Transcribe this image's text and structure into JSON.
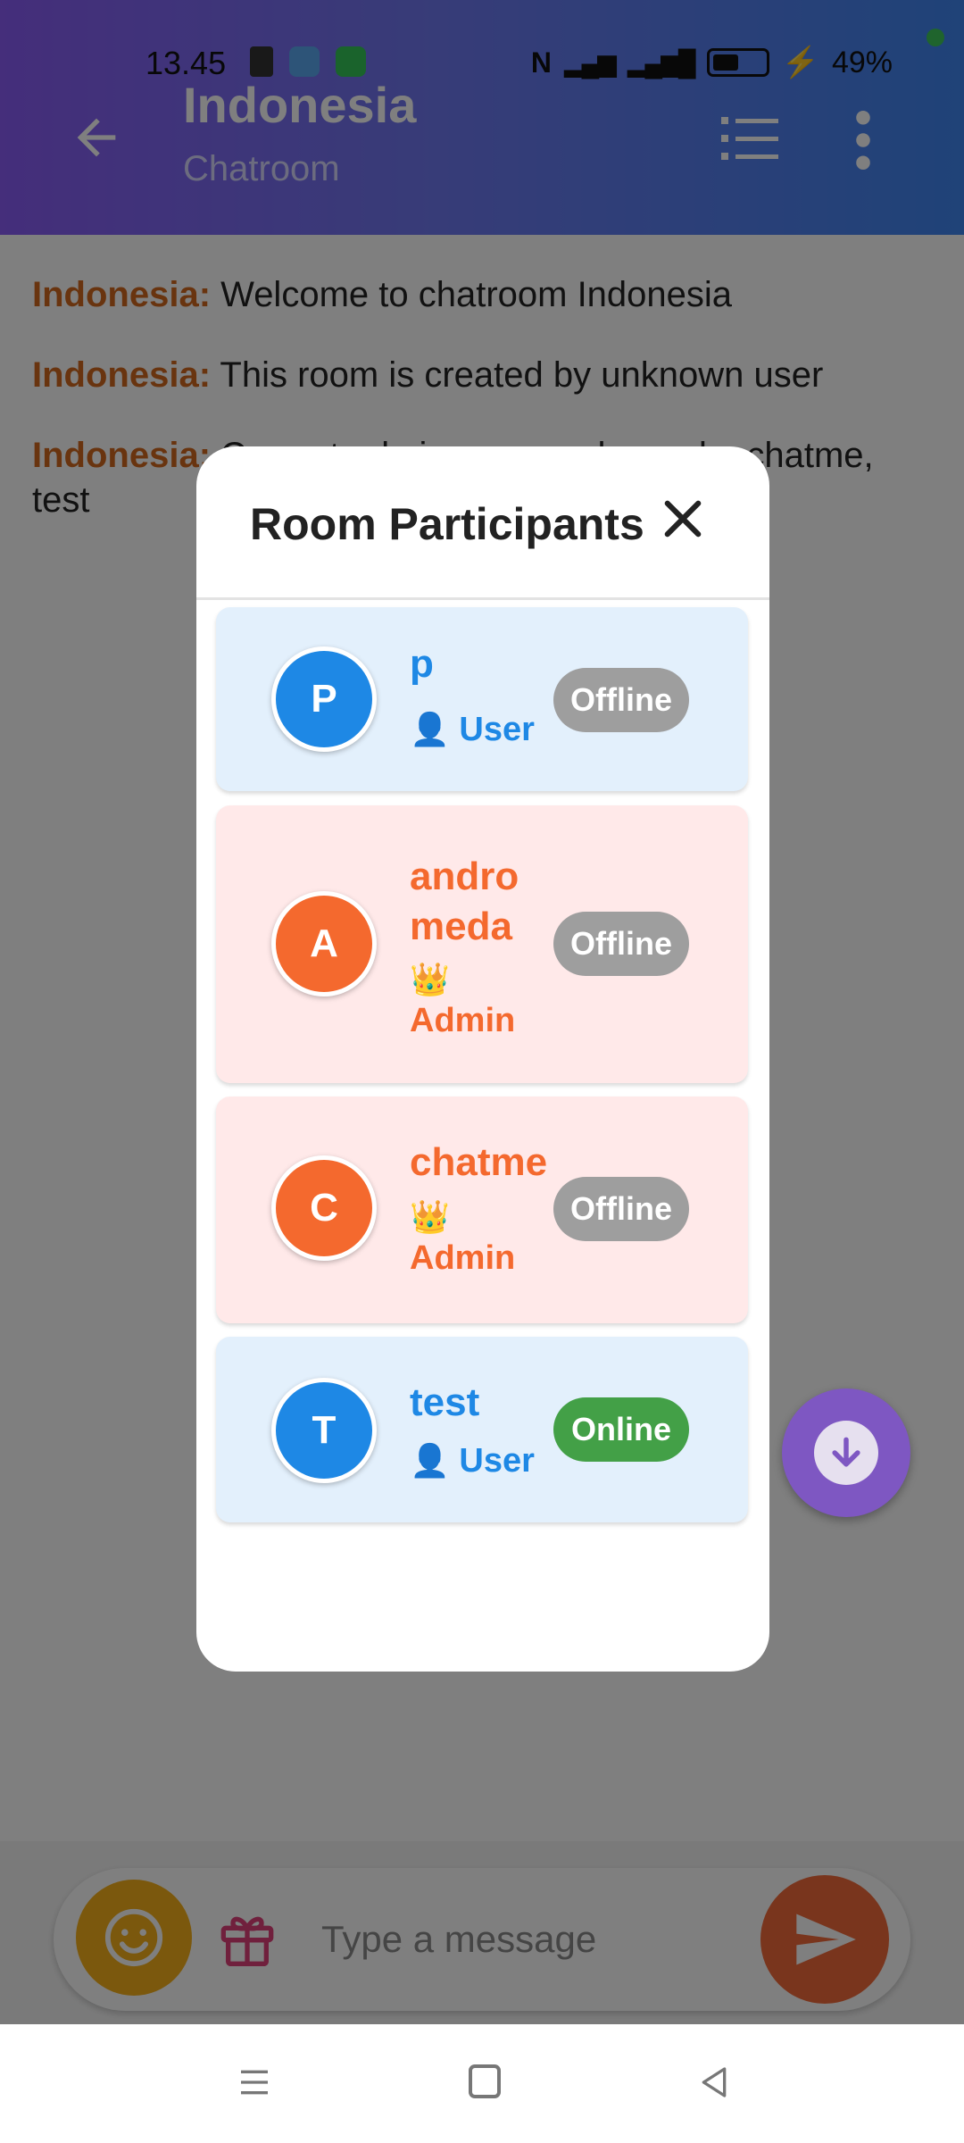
{
  "status_bar": {
    "time": "13.45",
    "battery": "49%"
  },
  "app_bar": {
    "title": "Indonesia",
    "subtitle": "Chatroom"
  },
  "messages": [
    {
      "sender": "Indonesia:",
      "text": "Welcome to chatroom Indonesia"
    },
    {
      "sender": "Indonesia:",
      "text": "This room is created by unknown user"
    },
    {
      "sender": "Indonesia:",
      "text": "Current admins are: andromeda, chatme, test"
    }
  ],
  "composer": {
    "placeholder": "Type a message"
  },
  "modal": {
    "title": "Room Participants",
    "participants": [
      {
        "initial": "P",
        "name": "p",
        "role_icon": "👤",
        "role": "User",
        "status": "Offline"
      },
      {
        "initial": "A",
        "name": "andro meda",
        "role_icon": "👑",
        "role": "Admin",
        "status": "Offline"
      },
      {
        "initial": "C",
        "name": "chatme",
        "role_icon": "👑",
        "role": "Admin",
        "status": "Offline"
      },
      {
        "initial": "T",
        "name": "test",
        "role_icon": "👤",
        "role": "User",
        "status": "Online"
      }
    ]
  },
  "colors": {
    "user_accent": "#1e88e5",
    "admin_accent": "#f4692e",
    "online": "#43a047",
    "offline": "#9e9e9e",
    "sender": "#d2691e"
  },
  "icons": [
    "back-arrow-icon",
    "list-icon",
    "more-vertical-icon",
    "close-icon",
    "arrow-down-icon",
    "emoji-icon",
    "gift-icon",
    "send-icon"
  ]
}
